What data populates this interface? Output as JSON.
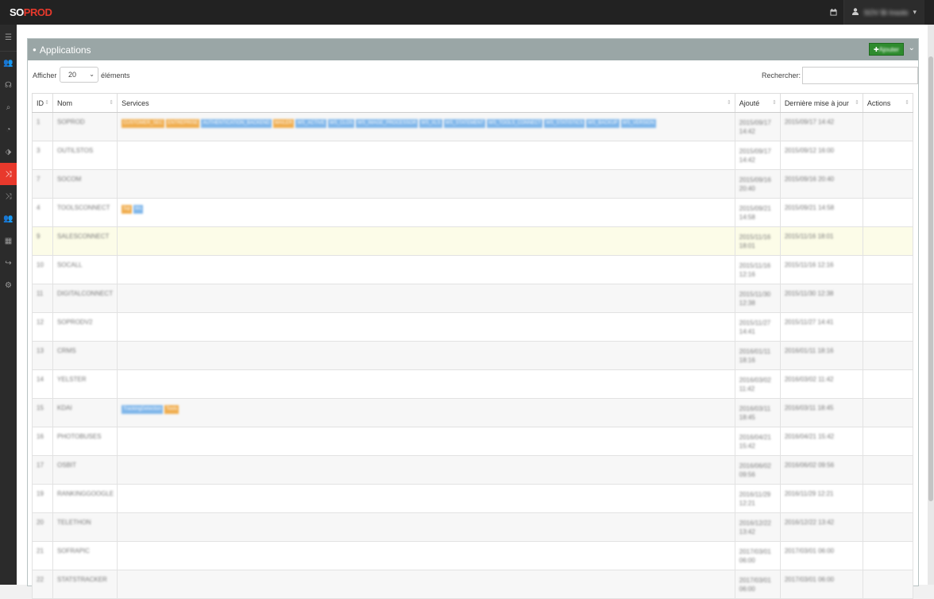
{
  "brand": {
    "part1": "SO",
    "part2": "PROD"
  },
  "topbar": {
    "user_name": "SOV Bi Insolo"
  },
  "panel": {
    "title": "Applications",
    "add_label": "Ajouter"
  },
  "controls": {
    "show_label": "Afficher",
    "show_value": "20",
    "show_after": "éléments",
    "search_label": "Rechercher:"
  },
  "table": {
    "headers": [
      "ID",
      "Nom",
      "Services",
      "Ajouté",
      "Dernière mise à jour",
      "Actions"
    ],
    "rows": [
      {
        "id": "1",
        "nom": "SOPROD",
        "services": [
          [
            "CUSTOMER_SEC",
            "o"
          ],
          [
            "ENTREPRISE",
            "o"
          ],
          [
            "AUTHENTICATION_BACKEND",
            "b"
          ],
          [
            "MAILER",
            "o"
          ],
          [
            "WS_ACTIVE",
            "b"
          ],
          [
            "WS_CLOS",
            "b"
          ],
          [
            "WS_IMAGE_PROCESSOR",
            "b"
          ],
          [
            "WS_XLS",
            "b"
          ],
          [
            "WS_STATEMENT",
            "b"
          ],
          [
            "WS_TOOLS_CONNECT",
            "b"
          ],
          [
            "WS_STATISTICS",
            "b"
          ],
          [
            "WS_BACKUP",
            "b"
          ],
          [
            "WS_VERSION",
            "b"
          ]
        ],
        "ajoute": [
          "2015/09/17",
          "14:42"
        ],
        "maj": "2015/09/17 14:42",
        "style": "odd"
      },
      {
        "id": "3",
        "nom": "OUTILSTOS",
        "services": [],
        "ajoute": [
          "2015/09/17",
          "14:42"
        ],
        "maj": "2015/09/12 16:00",
        "style": ""
      },
      {
        "id": "7",
        "nom": "SOCOM",
        "services": [],
        "ajoute": [
          "2015/09/16",
          "20:40"
        ],
        "maj": "2015/09/16 20:40",
        "style": "odd"
      },
      {
        "id": "4",
        "nom": "TOOLSCONNECT",
        "services": [
          [
            "Sql",
            "o"
          ],
          [
            "Ws",
            "b"
          ]
        ],
        "ajoute": [
          "2015/09/21",
          "14:58"
        ],
        "maj": "2015/09/21 14:58",
        "style": ""
      },
      {
        "id": "9",
        "nom": "SALESCONNECT",
        "services": [],
        "ajoute": [
          "2015/11/16",
          "18:01"
        ],
        "maj": "2015/11/16 18:01",
        "style": "hl"
      },
      {
        "id": "10",
        "nom": "SOCALL",
        "services": [],
        "ajoute": [
          "2015/11/16",
          "12:16"
        ],
        "maj": "2015/11/16 12:16",
        "style": ""
      },
      {
        "id": "11",
        "nom": "DIGITALCONNECT",
        "services": [],
        "ajoute": [
          "2015/11/30",
          "12:38"
        ],
        "maj": "2015/11/30 12:38",
        "style": "odd"
      },
      {
        "id": "12",
        "nom": "SOPRODV2",
        "services": [],
        "ajoute": [
          "2015/11/27",
          "14:41"
        ],
        "maj": "2015/11/27 14:41",
        "style": ""
      },
      {
        "id": "13",
        "nom": "CRMS",
        "services": [],
        "ajoute": [
          "2016/01/11",
          "18:16"
        ],
        "maj": "2016/01/11 18:16",
        "style": "odd"
      },
      {
        "id": "14",
        "nom": "YELSTER",
        "services": [],
        "ajoute": [
          "2016/03/02",
          "11:42"
        ],
        "maj": "2016/03/02 11:42",
        "style": ""
      },
      {
        "id": "15",
        "nom": "KDAI",
        "services": [
          [
            "TrackingDetection",
            "b"
          ],
          [
            "Tools",
            "o"
          ]
        ],
        "ajoute": [
          "2016/03/11",
          "18:45"
        ],
        "maj": "2016/03/11 18:45",
        "style": "odd"
      },
      {
        "id": "16",
        "nom": "PHOTOBUSES",
        "services": [],
        "ajoute": [
          "2016/04/21",
          "15:42"
        ],
        "maj": "2016/04/21 15:42",
        "style": ""
      },
      {
        "id": "17",
        "nom": "OSBIT",
        "services": [],
        "ajoute": [
          "2016/06/02",
          "09:56"
        ],
        "maj": "2016/06/02 09:56",
        "style": "odd"
      },
      {
        "id": "19",
        "nom": "RANKINGGOOGLE",
        "services": [],
        "ajoute": [
          "2016/11/29",
          "12:21"
        ],
        "maj": "2016/11/29 12:21",
        "style": ""
      },
      {
        "id": "20",
        "nom": "TELETHON",
        "services": [],
        "ajoute": [
          "2016/12/22",
          "13:42"
        ],
        "maj": "2016/12/22 13:42",
        "style": "odd"
      },
      {
        "id": "21",
        "nom": "SOFRAPIC",
        "services": [],
        "ajoute": [
          "2017/03/01",
          "06:00"
        ],
        "maj": "2017/03/01 06:00",
        "style": ""
      },
      {
        "id": "22",
        "nom": "STATSTRACKER",
        "services": [],
        "ajoute": [
          "2017/03/01",
          "06:00"
        ],
        "maj": "2017/03/01 06:00",
        "style": "odd"
      }
    ]
  },
  "colors": {
    "accent": "#e8392c",
    "panel_header": "#9aa6a6",
    "add_button": "#2e8b2e",
    "tag_orange": "#f0ad4e",
    "tag_blue": "#7fb6ea"
  }
}
